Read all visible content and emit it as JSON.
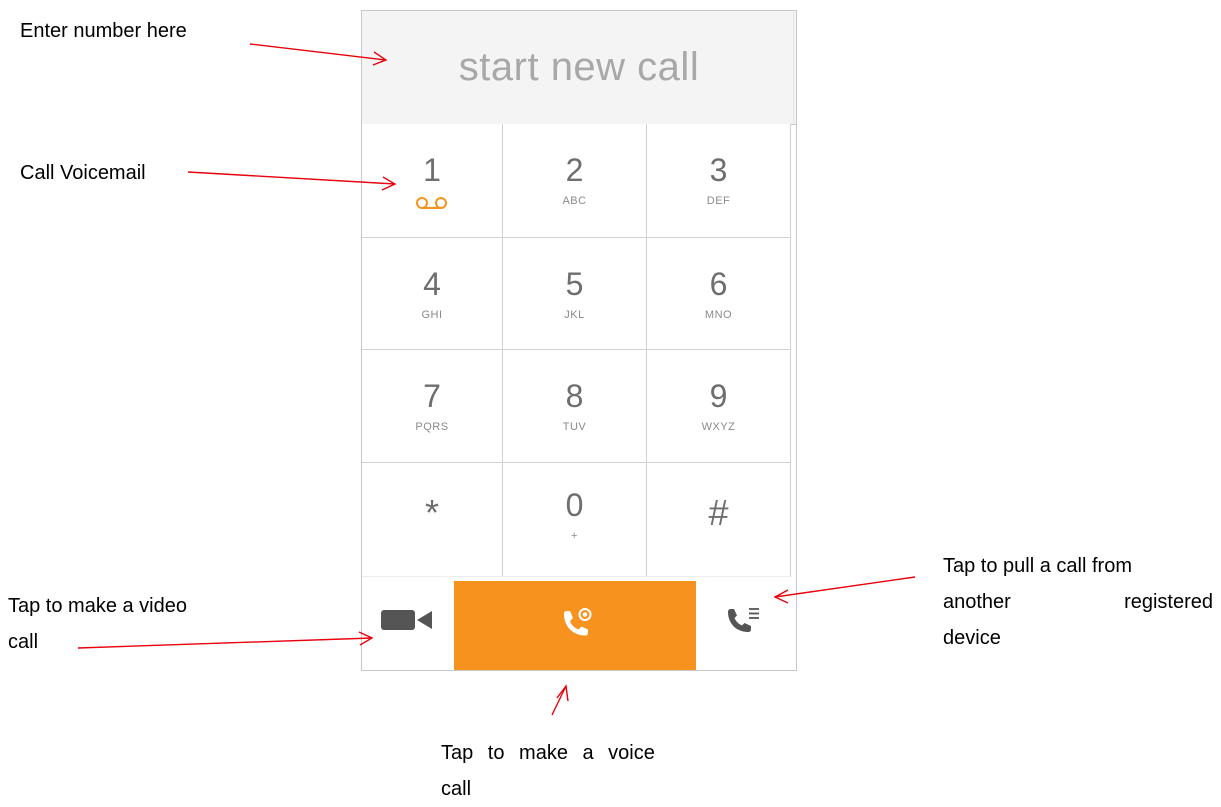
{
  "annotations": {
    "enter_number": "Enter number here",
    "call_voicemail": "Call Voicemail",
    "video_call_line1": "Tap to make a video",
    "video_call_line2": "call",
    "pull_call_line1": "Tap to pull a call from",
    "pull_call_line2a": "another",
    "pull_call_line2b": "registered",
    "pull_call_line3": "device",
    "voice_call_line1": "Tap to make a voice",
    "voice_call_line2": "call"
  },
  "dialer": {
    "placeholder": "start new call",
    "keys": [
      {
        "digit": "1",
        "letters": "",
        "icon": "voicemail-icon"
      },
      {
        "digit": "2",
        "letters": "ABC"
      },
      {
        "digit": "3",
        "letters": "DEF"
      },
      {
        "digit": "4",
        "letters": "GHI"
      },
      {
        "digit": "5",
        "letters": "JKL"
      },
      {
        "digit": "6",
        "letters": "MNO"
      },
      {
        "digit": "7",
        "letters": "PQRS"
      },
      {
        "digit": "8",
        "letters": "TUV"
      },
      {
        "digit": "9",
        "letters": "WXYZ"
      },
      {
        "digit": "*",
        "letters": ""
      },
      {
        "digit": "0",
        "letters": "+"
      },
      {
        "digit": "#",
        "letters": ""
      }
    ],
    "actions": {
      "video_icon": "video-camera-icon",
      "voice_icon": "phone-call-icon",
      "pull_icon": "call-pull-icon"
    }
  },
  "colors": {
    "accent": "#f7921e",
    "arrow": "#e8000d",
    "voicemail": "#f7921e",
    "text_gray": "#6e6e6e"
  }
}
